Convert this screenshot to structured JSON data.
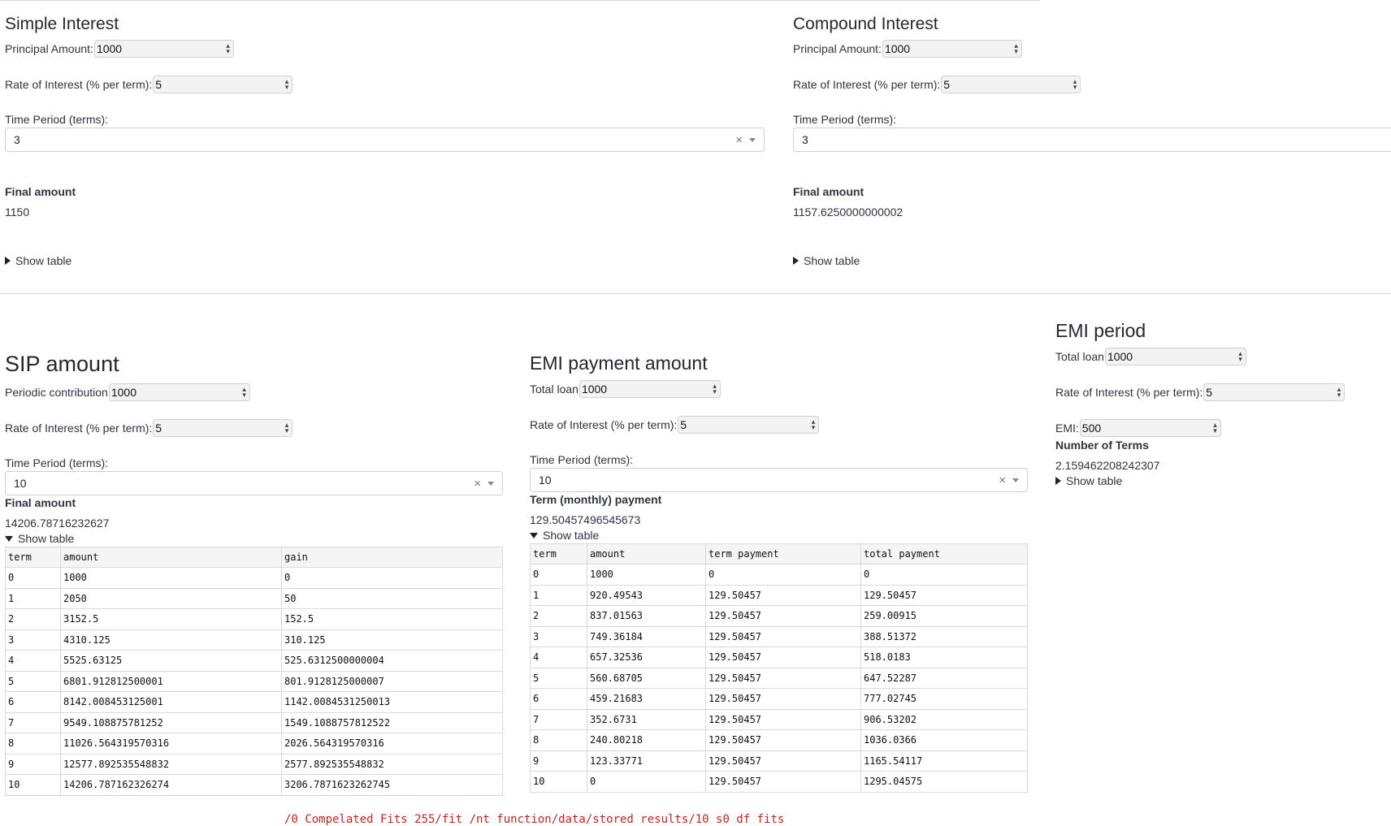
{
  "simple": {
    "title": "Simple Interest",
    "principal_label": "Principal Amount:",
    "principal_value": "1000",
    "rate_label": "Rate of Interest (% per term):",
    "rate_value": "5",
    "time_label": "Time Period (terms):",
    "time_value": "3",
    "final_label": "Final amount",
    "final_value": "1150",
    "show_table": "Show table"
  },
  "compound": {
    "title": "Compound Interest",
    "principal_label": "Principal Amount:",
    "principal_value": "1000",
    "rate_label": "Rate of Interest (% per term):",
    "rate_value": "5",
    "time_label": "Time Period (terms):",
    "time_value": "3",
    "final_label": "Final amount",
    "final_value": "1157.6250000000002",
    "show_table": "Show table"
  },
  "sip": {
    "title": "SIP amount",
    "contribution_label": "Periodic contribution",
    "contribution_value": "1000",
    "rate_label": "Rate of Interest (% per term):",
    "rate_value": "5",
    "time_label": "Time Period (terms):",
    "time_value": "10",
    "final_label": "Final amount",
    "final_value": "14206.78716232627",
    "show_table": "Show table",
    "columns": [
      "term",
      "amount",
      "gain"
    ],
    "rows": [
      [
        "0",
        "1000",
        "0"
      ],
      [
        "1",
        "2050",
        "50"
      ],
      [
        "2",
        "3152.5",
        "152.5"
      ],
      [
        "3",
        "4310.125",
        "310.125"
      ],
      [
        "4",
        "5525.63125",
        "525.6312500000004"
      ],
      [
        "5",
        "6801.912812500001",
        "801.9128125000007"
      ],
      [
        "6",
        "8142.008453125001",
        "1142.0084531250013"
      ],
      [
        "7",
        "9549.108875781252",
        "1549.1088757812522"
      ],
      [
        "8",
        "11026.564319570316",
        "2026.564319570316"
      ],
      [
        "9",
        "12577.892535548832",
        "2577.892535548832"
      ],
      [
        "10",
        "14206.787162326274",
        "3206.7871623262745"
      ]
    ]
  },
  "emi_payment": {
    "title": "EMI payment amount",
    "loan_label": "Total loan",
    "loan_value": "1000",
    "rate_label": "Rate of Interest (% per term):",
    "rate_value": "5",
    "time_label": "Time Period (terms):",
    "time_value": "10",
    "payment_label": "Term (monthly) payment",
    "payment_value": "129.50457496545673",
    "show_table": "Show table",
    "columns": [
      "term",
      "amount",
      "term payment",
      "total payment"
    ],
    "rows": [
      [
        "0",
        "1000",
        "0",
        "0"
      ],
      [
        "1",
        "920.49543",
        "129.50457",
        "129.50457"
      ],
      [
        "2",
        "837.01563",
        "129.50457",
        "259.00915"
      ],
      [
        "3",
        "749.36184",
        "129.50457",
        "388.51372"
      ],
      [
        "4",
        "657.32536",
        "129.50457",
        "518.0183"
      ],
      [
        "5",
        "560.68705",
        "129.50457",
        "647.52287"
      ],
      [
        "6",
        "459.21683",
        "129.50457",
        "777.02745"
      ],
      [
        "7",
        "352.6731",
        "129.50457",
        "906.53202"
      ],
      [
        "8",
        "240.80218",
        "129.50457",
        "1036.0366"
      ],
      [
        "9",
        "123.33771",
        "129.50457",
        "1165.54117"
      ],
      [
        "10",
        "0",
        "129.50457",
        "1295.04575"
      ]
    ]
  },
  "emi_period": {
    "title": "EMI period",
    "loan_label": "Total loan",
    "loan_value": "1000",
    "rate_label": "Rate of Interest (% per term):",
    "rate_value": "5",
    "emi_label": "EMI:",
    "emi_value": "500",
    "terms_label": "Number of Terms",
    "terms_value": "2.159462208242307",
    "show_table": "Show table"
  },
  "error_text": "/0 Compelated Fits 255/fit /nt function/data/stored results/10 s0 df fits"
}
